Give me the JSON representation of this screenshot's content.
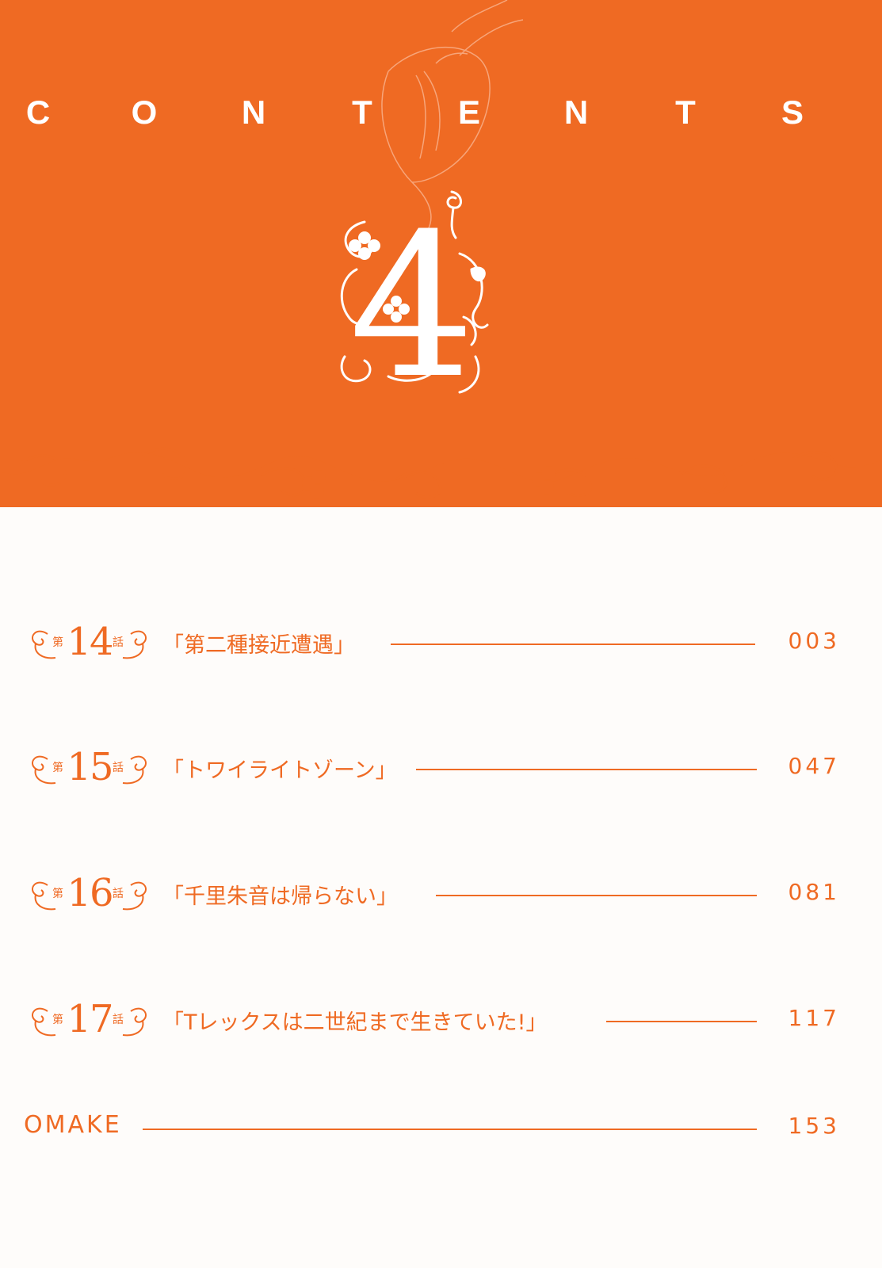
{
  "header": {
    "title_letters": [
      "C",
      "O",
      "N",
      "T",
      "E",
      "N",
      "T",
      "S"
    ],
    "volume_number": "4",
    "brand_color": "#ef6a23"
  },
  "toc": {
    "chapters": [
      {
        "prefix": "第",
        "number": "14",
        "suffix": "話",
        "title": "「第二種接近遭遇」",
        "page": "003"
      },
      {
        "prefix": "第",
        "number": "15",
        "suffix": "話",
        "title": "「トワイライトゾーン」",
        "page": "047"
      },
      {
        "prefix": "第",
        "number": "16",
        "suffix": "話",
        "title": "「千里朱音は帰らない」",
        "page": "081"
      },
      {
        "prefix": "第",
        "number": "17",
        "suffix": "話",
        "title": "「Tレックスは二世紀まで生きていた!」",
        "page": "117"
      }
    ],
    "omake": {
      "label": "OMAKE",
      "page": "153"
    }
  }
}
